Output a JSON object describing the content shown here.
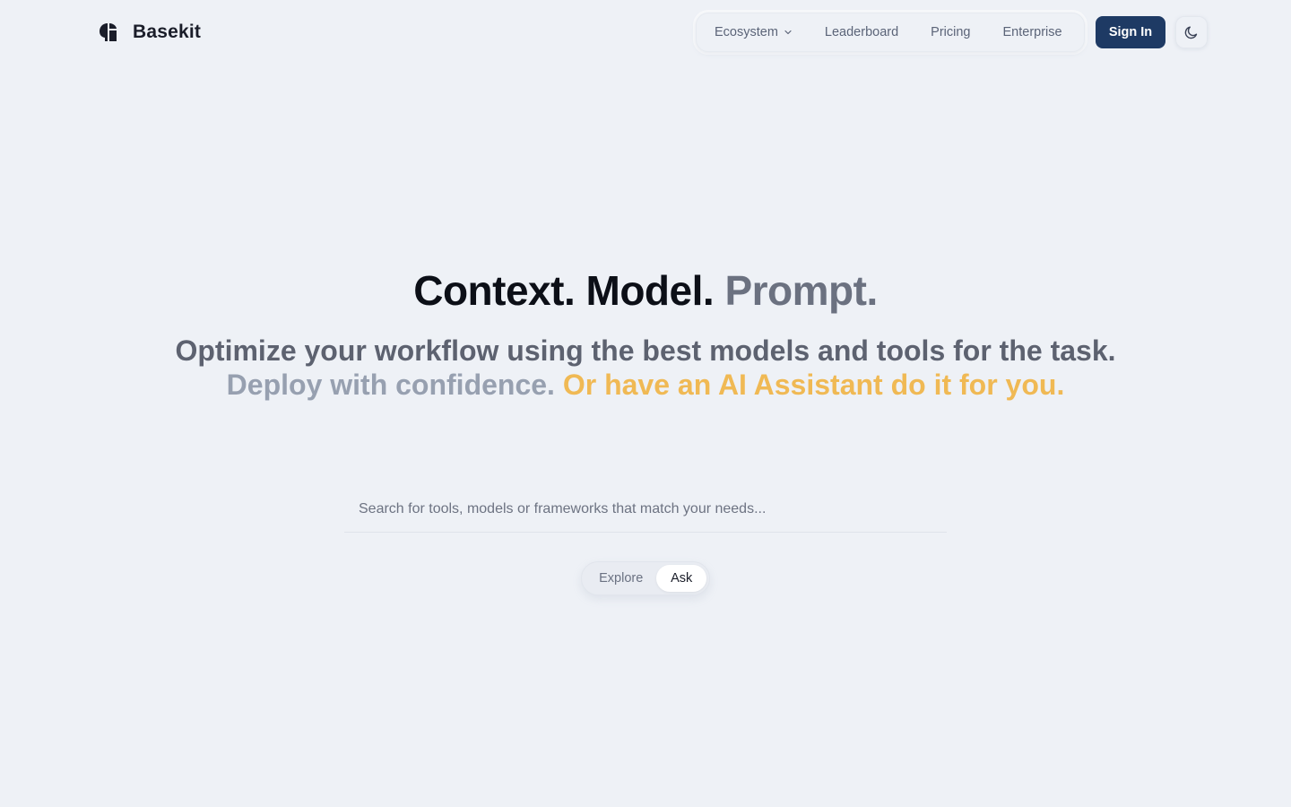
{
  "brand": {
    "name": "Basekit",
    "logo_icon": "basekit-logo-icon"
  },
  "nav": {
    "items": [
      {
        "label": "Ecosystem",
        "has_dropdown": true
      },
      {
        "label": "Leaderboard"
      },
      {
        "label": "Pricing"
      },
      {
        "label": "Enterprise"
      }
    ]
  },
  "header": {
    "signin_label": "Sign In",
    "theme_icon": "moon-icon"
  },
  "hero": {
    "title_dark": "Context. Model.",
    "title_gray": "Prompt.",
    "subtitle_line1": "Optimize your workflow using the best models and tools for the task.",
    "subtitle_line2_light": "Deploy with confidence.",
    "subtitle_line2_accent": "Or have an AI Assistant do it for you."
  },
  "search": {
    "value": "",
    "placeholder": "Search for tools, models or frameworks that match your needs..."
  },
  "mode": {
    "options": [
      "Explore",
      "Ask"
    ],
    "selected": "Ask"
  },
  "colors": {
    "background": "#eef1f6",
    "primary": "#1e3a64",
    "accent": "#f0b954"
  }
}
